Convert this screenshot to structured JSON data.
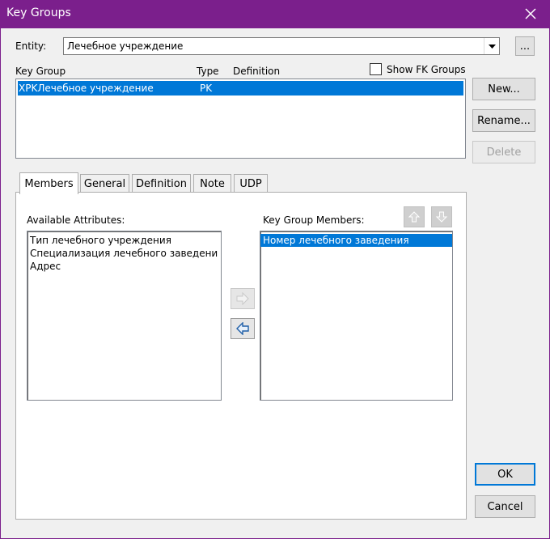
{
  "window": {
    "title": "Key Groups"
  },
  "entity": {
    "label": "Entity:",
    "value": "Лечебное учреждение",
    "browse_label": "..."
  },
  "key_group_list": {
    "columns": [
      "Key Group",
      "Type",
      "Definition"
    ],
    "rows": [
      {
        "key_group": "XPKЛечебное учреждение",
        "type": "PK",
        "definition": ""
      }
    ]
  },
  "show_fk": {
    "label": "Show FK Groups",
    "checked": false
  },
  "side_buttons": {
    "new": "New...",
    "rename": "Rename...",
    "delete": "Delete"
  },
  "tabs": [
    "Members",
    "General",
    "Definition",
    "Note",
    "UDP"
  ],
  "members": {
    "available_label": "Available Attributes:",
    "available_items": [
      "Тип лечебного учреждения",
      "Специализация лечебного заведени",
      "Адрес"
    ],
    "group_label": "Key Group Members:",
    "group_items": [
      "Номер лечебного заведения"
    ]
  },
  "footer": {
    "ok": "OK",
    "cancel": "Cancel"
  },
  "colors": {
    "titlebar": "#7b1f8c",
    "selection": "#0078d7"
  }
}
